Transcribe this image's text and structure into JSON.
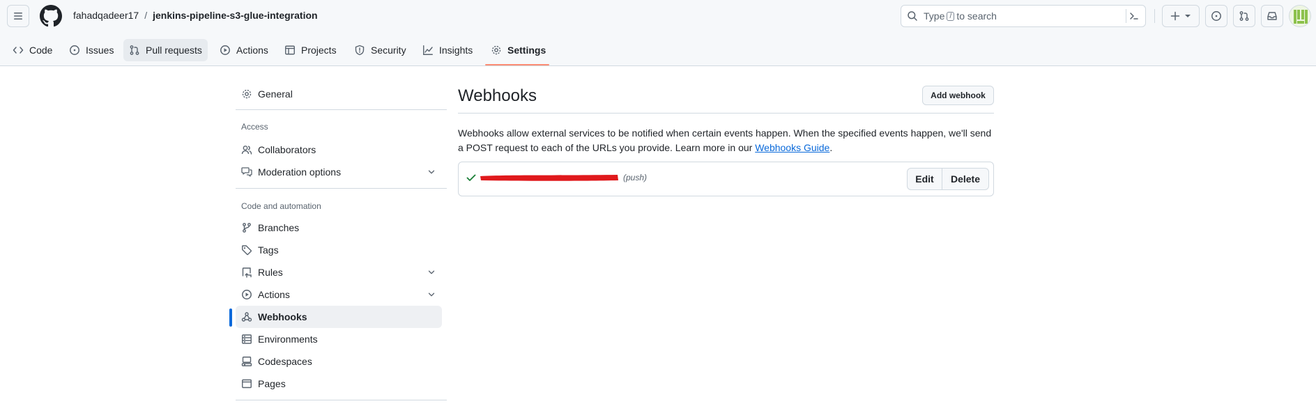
{
  "header": {
    "owner": "fahadqadeer17",
    "separator": "/",
    "repo": "jenkins-pipeline-s3-glue-integration",
    "search": {
      "prefix": "Type",
      "key": "/",
      "suffix": "to search"
    }
  },
  "tabs": [
    {
      "label": "Code",
      "icon": "code-icon"
    },
    {
      "label": "Issues",
      "icon": "issue-icon"
    },
    {
      "label": "Pull requests",
      "icon": "pull-request-icon"
    },
    {
      "label": "Actions",
      "icon": "play-icon"
    },
    {
      "label": "Projects",
      "icon": "table-icon"
    },
    {
      "label": "Security",
      "icon": "shield-icon"
    },
    {
      "label": "Insights",
      "icon": "graph-icon"
    },
    {
      "label": "Settings",
      "icon": "gear-icon",
      "selected": true
    }
  ],
  "sidebar": {
    "general": "General",
    "access_heading": "Access",
    "collaborators": "Collaborators",
    "moderation": "Moderation options",
    "code_heading": "Code and automation",
    "branches": "Branches",
    "tags": "Tags",
    "rules": "Rules",
    "actions": "Actions",
    "webhooks": "Webhooks",
    "environments": "Environments",
    "codespaces": "Codespaces",
    "pages": "Pages"
  },
  "main": {
    "title": "Webhooks",
    "add_button": "Add webhook",
    "description": "Webhooks allow external services to be notified when certain events happen. When the specified events happen, we'll send a POST request to each of the URLs you provide. Learn more in our ",
    "guide_link": "Webhooks Guide",
    "description_end": ".",
    "webhook": {
      "event": "(push)",
      "edit_label": "Edit",
      "delete_label": "Delete"
    }
  },
  "colors": {
    "accent": "#0969da",
    "tab_underline": "#fd8c73",
    "success": "#1a7f37",
    "redaction": "#e0191c"
  }
}
